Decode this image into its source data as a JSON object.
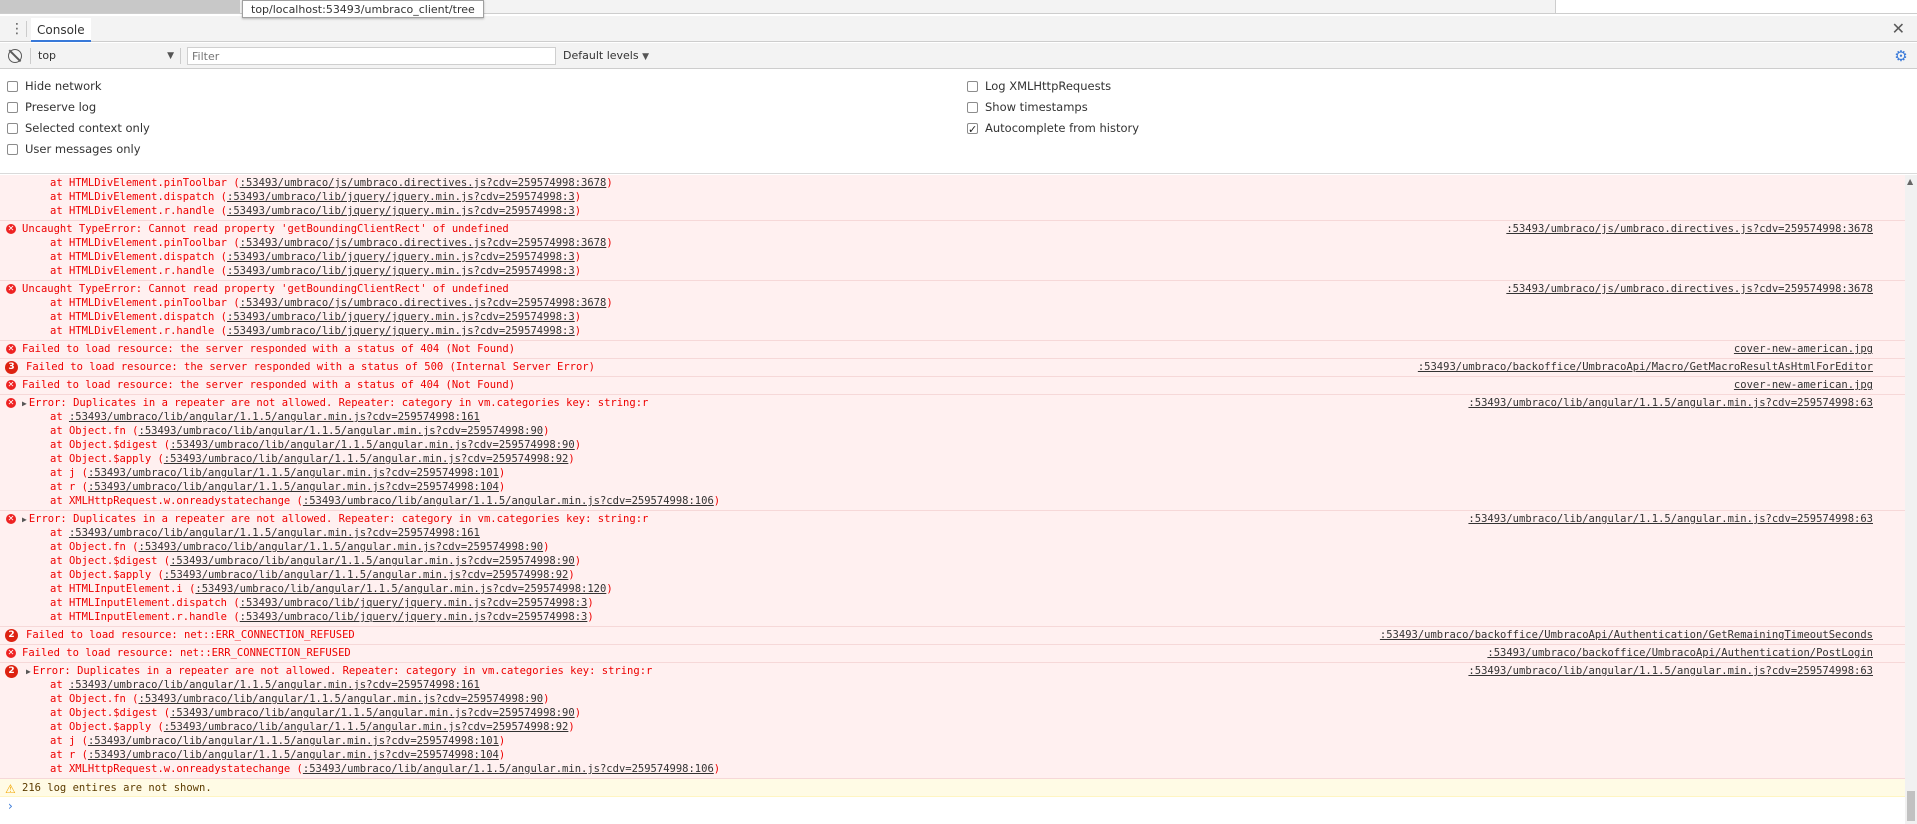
{
  "tooltip": "top/localhost:53493/umbraco_client/tree",
  "tabbar": {
    "tab_label": "Console"
  },
  "toolbar": {
    "context": "top",
    "filter_placeholder": "Filter",
    "levels": "Default levels"
  },
  "settings": {
    "left": [
      {
        "label": "Hide network",
        "checked": false
      },
      {
        "label": "Preserve log",
        "checked": false
      },
      {
        "label": "Selected context only",
        "checked": false
      },
      {
        "label": "User messages only",
        "checked": false
      }
    ],
    "right": [
      {
        "label": "Log XMLHttpRequests",
        "checked": false
      },
      {
        "label": "Show timestamps",
        "checked": false
      },
      {
        "label": "Autocomplete from history",
        "checked": true
      }
    ]
  },
  "messages": [
    {
      "kind": "trace-only",
      "trace": [
        {
          "pre": "at HTMLDivElement.pinToolbar (",
          "link": ":53493/umbraco/js/umbraco.directives.js?cdv=259574998:3678",
          "post": ")"
        },
        {
          "pre": "at HTMLDivElement.dispatch (",
          "link": ":53493/umbraco/lib/jquery/jquery.min.js?cdv=259574998:3",
          "post": ")"
        },
        {
          "pre": "at HTMLDivElement.r.handle (",
          "link": ":53493/umbraco/lib/jquery/jquery.min.js?cdv=259574998:3",
          "post": ")"
        }
      ]
    },
    {
      "kind": "error",
      "text": "Uncaught TypeError: Cannot read property 'getBoundingClientRect' of undefined",
      "source": ":53493/umbraco/js/umbraco.directives.js?cdv=259574998:3678",
      "trace": [
        {
          "pre": "at HTMLDivElement.pinToolbar (",
          "link": ":53493/umbraco/js/umbraco.directives.js?cdv=259574998:3678",
          "post": ")"
        },
        {
          "pre": "at HTMLDivElement.dispatch (",
          "link": ":53493/umbraco/lib/jquery/jquery.min.js?cdv=259574998:3",
          "post": ")"
        },
        {
          "pre": "at HTMLDivElement.r.handle (",
          "link": ":53493/umbraco/lib/jquery/jquery.min.js?cdv=259574998:3",
          "post": ")"
        }
      ]
    },
    {
      "kind": "error",
      "text": "Uncaught TypeError: Cannot read property 'getBoundingClientRect' of undefined",
      "source": ":53493/umbraco/js/umbraco.directives.js?cdv=259574998:3678",
      "trace": [
        {
          "pre": "at HTMLDivElement.pinToolbar (",
          "link": ":53493/umbraco/js/umbraco.directives.js?cdv=259574998:3678",
          "post": ")"
        },
        {
          "pre": "at HTMLDivElement.dispatch (",
          "link": ":53493/umbraco/lib/jquery/jquery.min.js?cdv=259574998:3",
          "post": ")"
        },
        {
          "pre": "at HTMLDivElement.r.handle (",
          "link": ":53493/umbraco/lib/jquery/jquery.min.js?cdv=259574998:3",
          "post": ")"
        }
      ]
    },
    {
      "kind": "error",
      "text": "Failed to load resource: the server responded with a status of 404 (Not Found)",
      "source": "cover-new-american.jpg",
      "trace": []
    },
    {
      "kind": "error",
      "count": "3",
      "text": "Failed to load resource: the server responded with a status of 500 (Internal Server Error)",
      "source": ":53493/umbraco/backoffice/UmbracoApi/Macro/GetMacroResultAsHtmlForEditor",
      "trace": []
    },
    {
      "kind": "error",
      "text": "Failed to load resource: the server responded with a status of 404 (Not Found)",
      "source": "cover-new-american.jpg",
      "trace": []
    },
    {
      "kind": "error",
      "expand": true,
      "text": "Error: Duplicates in a repeater are not allowed. Repeater: category in vm.categories key: string:r",
      "source": ":53493/umbraco/lib/angular/1.1.5/angular.min.js?cdv=259574998:63",
      "trace": [
        {
          "pre": "at ",
          "link": ":53493/umbraco/lib/angular/1.1.5/angular.min.js?cdv=259574998:161",
          "post": ""
        },
        {
          "pre": "at Object.fn (",
          "link": ":53493/umbraco/lib/angular/1.1.5/angular.min.js?cdv=259574998:90",
          "post": ")"
        },
        {
          "pre": "at Object.$digest (",
          "link": ":53493/umbraco/lib/angular/1.1.5/angular.min.js?cdv=259574998:90",
          "post": ")"
        },
        {
          "pre": "at Object.$apply (",
          "link": ":53493/umbraco/lib/angular/1.1.5/angular.min.js?cdv=259574998:92",
          "post": ")"
        },
        {
          "pre": "at j (",
          "link": ":53493/umbraco/lib/angular/1.1.5/angular.min.js?cdv=259574998:101",
          "post": ")"
        },
        {
          "pre": "at r (",
          "link": ":53493/umbraco/lib/angular/1.1.5/angular.min.js?cdv=259574998:104",
          "post": ")"
        },
        {
          "pre": "at XMLHttpRequest.w.onreadystatechange (",
          "link": ":53493/umbraco/lib/angular/1.1.5/angular.min.js?cdv=259574998:106",
          "post": ")"
        }
      ]
    },
    {
      "kind": "error",
      "expand": true,
      "text": "Error: Duplicates in a repeater are not allowed. Repeater: category in vm.categories key: string:r",
      "source": ":53493/umbraco/lib/angular/1.1.5/angular.min.js?cdv=259574998:63",
      "trace": [
        {
          "pre": "at ",
          "link": ":53493/umbraco/lib/angular/1.1.5/angular.min.js?cdv=259574998:161",
          "post": ""
        },
        {
          "pre": "at Object.fn (",
          "link": ":53493/umbraco/lib/angular/1.1.5/angular.min.js?cdv=259574998:90",
          "post": ")"
        },
        {
          "pre": "at Object.$digest (",
          "link": ":53493/umbraco/lib/angular/1.1.5/angular.min.js?cdv=259574998:90",
          "post": ")"
        },
        {
          "pre": "at Object.$apply (",
          "link": ":53493/umbraco/lib/angular/1.1.5/angular.min.js?cdv=259574998:92",
          "post": ")"
        },
        {
          "pre": "at HTMLInputElement.i (",
          "link": ":53493/umbraco/lib/angular/1.1.5/angular.min.js?cdv=259574998:120",
          "post": ")"
        },
        {
          "pre": "at HTMLInputElement.dispatch (",
          "link": ":53493/umbraco/lib/jquery/jquery.min.js?cdv=259574998:3",
          "post": ")"
        },
        {
          "pre": "at HTMLInputElement.r.handle (",
          "link": ":53493/umbraco/lib/jquery/jquery.min.js?cdv=259574998:3",
          "post": ")"
        }
      ]
    },
    {
      "kind": "error",
      "count": "2",
      "text": "Failed to load resource: net::ERR_CONNECTION_REFUSED",
      "source": ":53493/umbraco/backoffice/UmbracoApi/Authentication/GetRemainingTimeoutSeconds",
      "trace": []
    },
    {
      "kind": "error",
      "text": "Failed to load resource: net::ERR_CONNECTION_REFUSED",
      "source": ":53493/umbraco/backoffice/UmbracoApi/Authentication/PostLogin",
      "trace": []
    },
    {
      "kind": "error",
      "count": "2",
      "expand": true,
      "text": "Error: Duplicates in a repeater are not allowed. Repeater: category in vm.categories key: string:r",
      "source": ":53493/umbraco/lib/angular/1.1.5/angular.min.js?cdv=259574998:63",
      "trace": [
        {
          "pre": "at ",
          "link": ":53493/umbraco/lib/angular/1.1.5/angular.min.js?cdv=259574998:161",
          "post": ""
        },
        {
          "pre": "at Object.fn (",
          "link": ":53493/umbraco/lib/angular/1.1.5/angular.min.js?cdv=259574998:90",
          "post": ")"
        },
        {
          "pre": "at Object.$digest (",
          "link": ":53493/umbraco/lib/angular/1.1.5/angular.min.js?cdv=259574998:90",
          "post": ")"
        },
        {
          "pre": "at Object.$apply (",
          "link": ":53493/umbraco/lib/angular/1.1.5/angular.min.js?cdv=259574998:92",
          "post": ")"
        },
        {
          "pre": "at j (",
          "link": ":53493/umbraco/lib/angular/1.1.5/angular.min.js?cdv=259574998:101",
          "post": ")"
        },
        {
          "pre": "at r (",
          "link": ":53493/umbraco/lib/angular/1.1.5/angular.min.js?cdv=259574998:104",
          "post": ")"
        },
        {
          "pre": "at XMLHttpRequest.w.onreadystatechange (",
          "link": ":53493/umbraco/lib/angular/1.1.5/angular.min.js?cdv=259574998:106",
          "post": ")"
        }
      ]
    }
  ],
  "warning": "216 log entires are not shown."
}
